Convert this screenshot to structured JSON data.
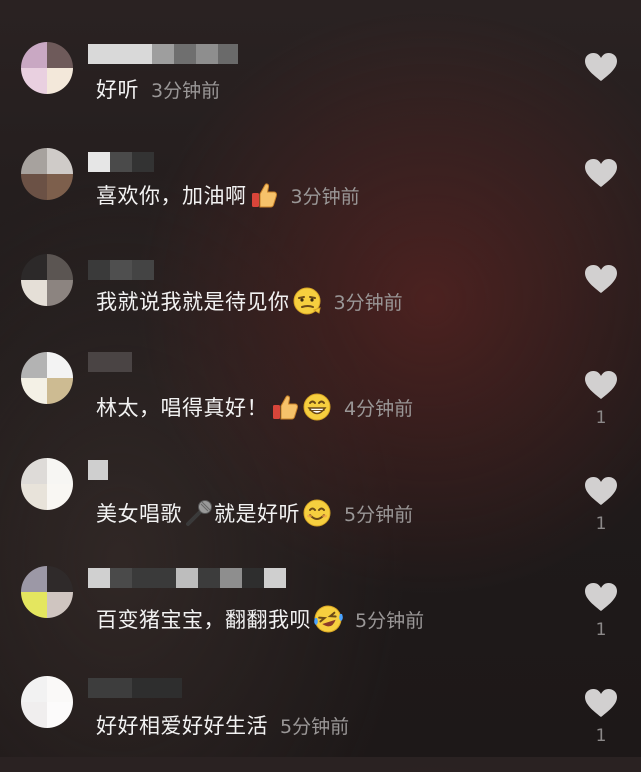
{
  "comments": [
    {
      "text": "好听",
      "time": "3分钟前",
      "emojis": [],
      "like_count": "",
      "avatar_colors": [
        "#c9a8c3",
        "#6e5a5a",
        "#e9d0e0",
        "#f3e8da"
      ],
      "username_colors": [
        "#d9d9d9",
        "#d9d9d9",
        "#b5b5b5",
        "#8e8e8e",
        "#6f6f6f",
        "#8a8a8a"
      ]
    },
    {
      "text": "喜欢你，加油啊",
      "time": "3分钟前",
      "emojis": [
        "thumbs-up-icon"
      ],
      "like_count": "",
      "avatar_colors": [
        "#a7a29e",
        "#cfcbc8",
        "#6b5145",
        "#7d5f4c"
      ],
      "username_colors": [
        "#e6e6e6",
        "#555",
        "#3c3c3c"
      ]
    },
    {
      "text": "我就说我就是待见你",
      "time": "3分钟前",
      "emojis": [
        "smirk-face-icon"
      ],
      "like_count": "",
      "avatar_colors": [
        "#2c2929",
        "#5b5552",
        "#e5dfd7",
        "#8c8480"
      ],
      "username_colors": [
        "#3a3a3a",
        "#5a5a5a",
        "#444"
      ]
    },
    {
      "text": "林太，唱得真好！",
      "time": "4分钟前",
      "emojis": [
        "thumbs-up-icon",
        "grin-face-icon"
      ],
      "like_count": "1",
      "avatar_colors": [
        "#b3b3b3",
        "#f3f3f3",
        "#f4f1e6",
        "#cdbb92"
      ],
      "username_colors": [
        "#cfcfcf",
        "#bdbdbd"
      ]
    },
    {
      "text": "美女唱歌",
      "text_after": "就是好听",
      "time": "5分钟前",
      "emojis": [
        "microphone-icon",
        "smile-face-icon"
      ],
      "like_count": "1",
      "avatar_colors": [
        "#dedbd8",
        "#f7f6f3",
        "#e8e3da",
        "#f9f7f3"
      ],
      "username_colors": [
        "#cfcfcf"
      ]
    },
    {
      "text": "百变猪宝宝，翻翻我呗",
      "time": "5分钟前",
      "emojis": [
        "laugh-cry-face-icon"
      ],
      "like_count": "1",
      "avatar_colors": [
        "#9c98a6",
        "#2f2a2a",
        "#e4e65f",
        "#cfc5c0"
      ],
      "username_colors": [
        "#d0d0d0",
        "#4a4a4a",
        "#3a3a3a",
        "#bdbdbd",
        "#3c3c3c",
        "#cfcfcf"
      ]
    },
    {
      "text": "好好相爱好好生活",
      "time": "5分钟前",
      "emojis": [],
      "like_count": "1",
      "avatar_colors": [
        "#f2f2f2",
        "#faf9f8",
        "#f0eeee",
        "#fcfbfb"
      ],
      "username_colors": [
        "#3d3d3d",
        "#555"
      ]
    }
  ]
}
